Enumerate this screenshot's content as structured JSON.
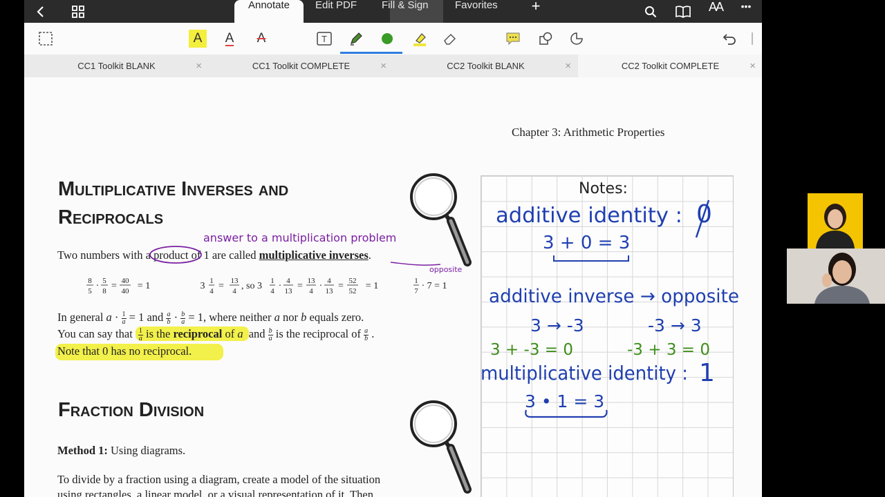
{
  "topbar": {
    "tabs": [
      "Annotate",
      "Edit PDF",
      "Fill & Sign",
      "Favorites"
    ],
    "add_label": "+",
    "text_size_label": "AA",
    "more_label": "•••"
  },
  "doc_tabs": [
    {
      "label": "CC1 Toolkit BLANK",
      "close": "×"
    },
    {
      "label": "CC1 Toolkit COMPLETE",
      "close": "×"
    },
    {
      "label": "CC2 Toolkit BLANK",
      "close": "×"
    },
    {
      "label": "CC2 Toolkit COMPLETE",
      "close": "×"
    }
  ],
  "tools": {
    "highlight_text_label": "A",
    "underline_text_label": "A",
    "strike_text_label": "A",
    "textbox_label": "T"
  },
  "page": {
    "chapter": "Chapter 3: Arithmetic Properties",
    "heading1_line1": "Multiplicative Inverses and",
    "heading1_line2": "Reciprocals",
    "intro_a": "Two numbers with a",
    "intro_product": "product",
    "intro_b": "of 1 are called",
    "intro_bold": "multiplicative inverses",
    "intro_end": ".",
    "general_a": "In general",
    "general_b": "and",
    "general_c": ", where neither",
    "general_d": "nor",
    "general_e": "equals zero.",
    "say_a": "You can say that",
    "say_b": "is the",
    "say_bold": "reciprocal",
    "say_c": "of",
    "say_d": "and",
    "say_e": "is the reciprocal of",
    "note": "Note that 0 has no reciprocal.",
    "heading2": "Fraction Division",
    "method_bold": "Method 1:",
    "method_text": "Using diagrams.",
    "divide_line1": "To divide by a fraction using a diagram, create a model of the situation",
    "divide_line2": "using rectangles, a linear model, or a visual representation of it. Then"
  },
  "handwriting": {
    "answer": "answer to a multiplication problem",
    "opposite": "opposite",
    "notes_title": "Notes:",
    "additive_identity": "additive identity :",
    "zero": "0",
    "ai_example": "3 + 0 = 3",
    "additive_inverse": "additive inverse → opposite",
    "ex1": "3 → -3",
    "ex2": "-3 → 3",
    "ex3": "3 + -3 = 0",
    "ex4": "-3 + 3 = 0",
    "mult_identity": "multiplicative identity :",
    "one": "1",
    "mi_example": "3 • 1 = 3"
  },
  "colors": {
    "purple": "#7a1fa2",
    "blue": "#1f3fb0",
    "green": "#3e8e1a",
    "highlight": "#f2f04a",
    "toolbar_bg": "#2b2b2b"
  }
}
